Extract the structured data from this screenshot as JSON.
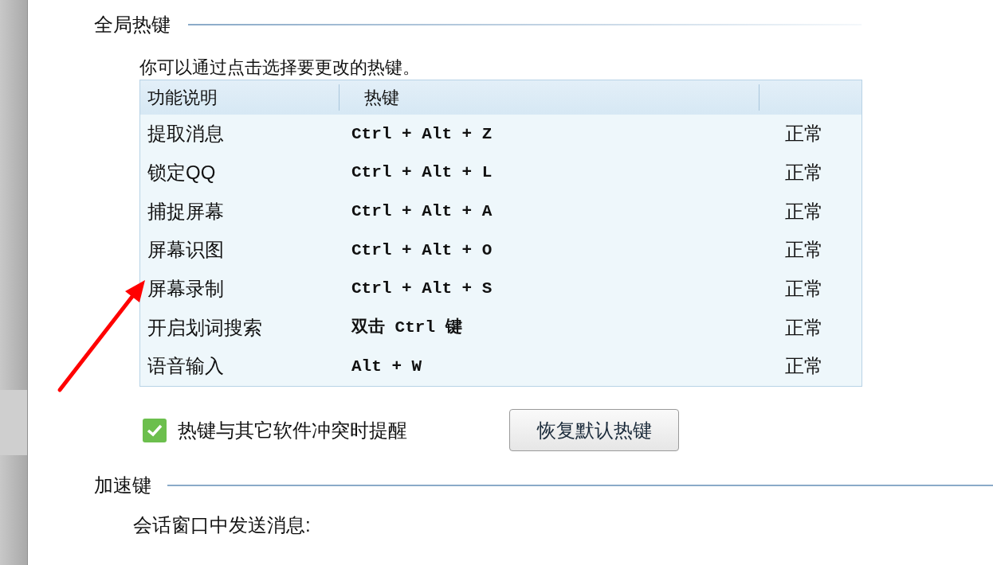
{
  "global_hotkeys": {
    "title": "全局热键",
    "description": "你可以通过点击选择要更改的热键。",
    "table": {
      "columns": [
        "功能说明",
        "热键"
      ],
      "rows": [
        {
          "function": "提取消息",
          "hotkey": "Ctrl + Alt + Z",
          "status": "正常"
        },
        {
          "function": "锁定QQ",
          "hotkey": "Ctrl + Alt + L",
          "status": "正常"
        },
        {
          "function": "捕捉屏幕",
          "hotkey": "Ctrl + Alt + A",
          "status": "正常"
        },
        {
          "function": "屏幕识图",
          "hotkey": "Ctrl + Alt + O",
          "status": "正常"
        },
        {
          "function": "屏幕录制",
          "hotkey": "Ctrl + Alt + S",
          "status": "正常"
        },
        {
          "function": "开启划词搜索",
          "hotkey": "双击 Ctrl 键",
          "status": "正常"
        },
        {
          "function": "语音输入",
          "hotkey": "Alt + W",
          "status": "正常"
        }
      ]
    },
    "conflict_reminder": {
      "label": "热键与其它软件冲突时提醒",
      "checked": true
    },
    "restore_button": "恢复默认热键"
  },
  "accelerator_keys": {
    "title": "加速键",
    "label": "会话窗口中发送消息:"
  }
}
